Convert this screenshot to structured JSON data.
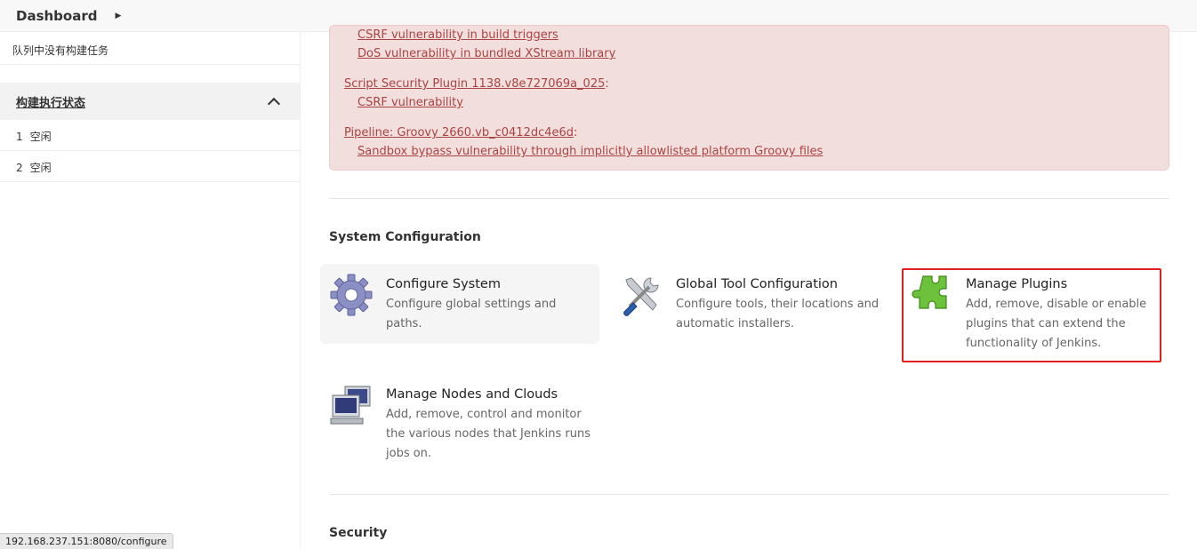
{
  "header": {
    "breadcrumb": "Dashboard"
  },
  "sidebar": {
    "queue_empty": "队列中没有构建任务",
    "executor_title": "构建执行状态",
    "executors": [
      {
        "num": "1",
        "status": "空闲"
      },
      {
        "num": "2",
        "status": "空闲"
      }
    ]
  },
  "status_bar": {
    "url": "192.168.237.151:8080/configure"
  },
  "alert": {
    "items": [
      {
        "sub": "CSRF vulnerability in build triggers"
      },
      {
        "sub": "DoS vulnerability in bundled XStream library"
      }
    ],
    "plugins": [
      {
        "name": "Script Security Plugin 1138.v8e727069a_025",
        "colon": ":",
        "issues": [
          "CSRF vulnerability"
        ]
      },
      {
        "name": "Pipeline: Groovy 2660.vb_c0412dc4e6d",
        "colon": ":",
        "issues": [
          "Sandbox bypass vulnerability through implicitly allowlisted platform Groovy files"
        ]
      }
    ]
  },
  "system_config": {
    "title": "System Configuration",
    "tiles": [
      {
        "title": "Configure System",
        "desc": "Configure global settings and paths.",
        "icon": "gear-icon"
      },
      {
        "title": "Global Tool Configuration",
        "desc": "Configure tools, their locations and automatic installers.",
        "icon": "tools-icon"
      },
      {
        "title": "Manage Plugins",
        "desc": "Add, remove, disable or enable plugins that can extend the functionality of Jenkins.",
        "icon": "puzzle-icon"
      },
      {
        "title": "Manage Nodes and Clouds",
        "desc": "Add, remove, control and monitor the various nodes that Jenkins runs jobs on.",
        "icon": "computers-icon"
      }
    ]
  },
  "security": {
    "title": "Security"
  },
  "colors": {
    "alert_bg": "#f3dede",
    "alert_link": "#a94442",
    "highlight": "#e02020"
  }
}
